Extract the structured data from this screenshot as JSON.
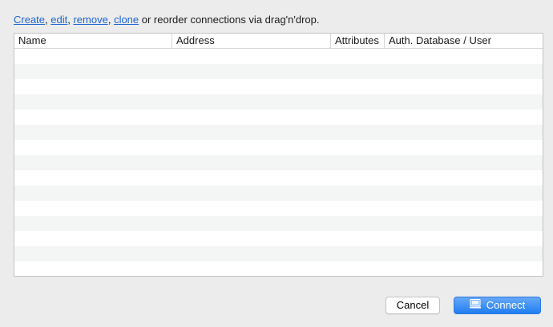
{
  "instructions": {
    "create_link": "Create",
    "sep1": ", ",
    "edit_link": "edit",
    "sep2": ", ",
    "remove_link": "remove",
    "sep3": ", ",
    "clone_link": "clone",
    "suffix": " or reorder connections via drag'n'drop."
  },
  "table": {
    "columns": [
      {
        "label": "Name"
      },
      {
        "label": "Address"
      },
      {
        "label": "Attributes"
      },
      {
        "label": "Auth. Database / User"
      }
    ],
    "rows": []
  },
  "buttons": {
    "cancel_label": "Cancel",
    "connect_label": "Connect"
  },
  "icons": {
    "connect_icon": "monitor-icon"
  },
  "colors": {
    "link": "#1c64d2",
    "accent": "#1f7ef2",
    "stripe": "#f4f5f5"
  }
}
